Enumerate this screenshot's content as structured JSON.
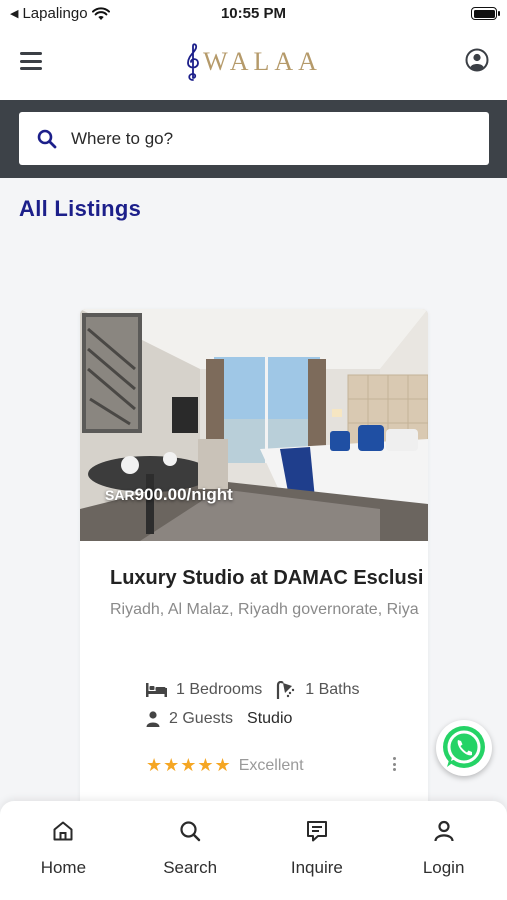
{
  "status_bar": {
    "back_app": "Lapalingo",
    "time": "10:55 PM"
  },
  "header": {
    "logo_text": "WALAA",
    "brand_color": "#b59a6a"
  },
  "search": {
    "placeholder": "Where to go?"
  },
  "section": {
    "title": "All Listings"
  },
  "listing": {
    "currency": "SAR",
    "price": "900.00/night",
    "title": "Luxury Studio at DAMAC Esclusi",
    "location": "Riyadh, Al Malaz, Riyadh governorate, Riya",
    "bedrooms": "1 Bedrooms",
    "baths": "1 Baths",
    "guests": "2 Guests",
    "type": "Studio",
    "rating_label": "Excellent",
    "stars": 5
  },
  "nav": {
    "items": [
      {
        "label": "Home",
        "icon": "home-icon"
      },
      {
        "label": "Search",
        "icon": "search-icon"
      },
      {
        "label": "Inquire",
        "icon": "chat-icon"
      },
      {
        "label": "Login",
        "icon": "user-icon"
      }
    ]
  },
  "colors": {
    "title_blue": "#1c1f8a",
    "search_band": "#3d4248",
    "star": "#f5a623",
    "whatsapp": "#25d366"
  }
}
